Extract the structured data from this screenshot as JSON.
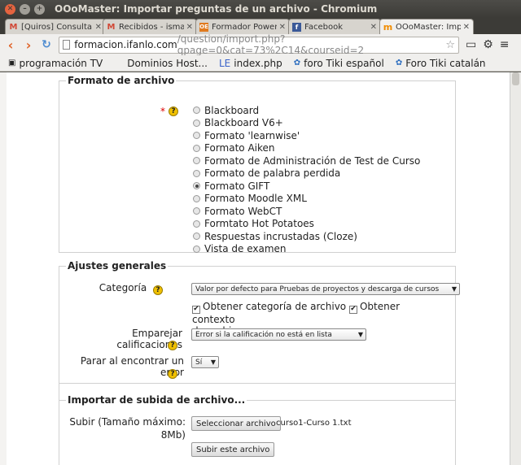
{
  "window": {
    "title": "OOoMaster: Importar preguntas de un archivo - Chromium"
  },
  "tabs": [
    {
      "label": "[Quiros] Consulta",
      "icon": "gmail-icon",
      "color": "#d14836"
    },
    {
      "label": "Recibidos - ismae",
      "icon": "gmail-icon",
      "color": "#d14836"
    },
    {
      "label": "Formador Power",
      "icon": "ooo-icon",
      "color": "#e07a1f"
    },
    {
      "label": "Facebook",
      "icon": "facebook-icon",
      "color": "#3b5998"
    },
    {
      "label": "OOoMaster: Impo",
      "icon": "moodle-icon",
      "color": "#f18c00"
    }
  ],
  "address": {
    "host": "formacion.ifanlo.com",
    "path": "/question/import.php?qpage=0&cat=73%2C14&courseid=2"
  },
  "bookmarks": [
    "programación TV",
    "Dominios Host...",
    "index.php",
    "foro Tiki español",
    "Foro Tiki catalán"
  ],
  "bookmark_prefix": "LE",
  "format_section": {
    "legend": "Formato de archivo",
    "options": [
      "Blackboard",
      "Blackboard V6+",
      "Formato 'learnwise'",
      "Formato Aiken",
      "Formato de Administración de Test de Curso",
      "Formato de palabra perdida",
      "Formato GIFT",
      "Formato Moodle XML",
      "Formato WebCT",
      "Formtato Hot Potatoes",
      "Respuestas incrustadas (Cloze)",
      "Vista de examen"
    ],
    "selected": "Formato GIFT"
  },
  "general_section": {
    "legend": "Ajustes generales",
    "category_label": "Categoría",
    "category_value": "Valor por defecto para Pruebas de proyectos y descarga de cursos",
    "category_from_file": "Obtener categoría de archivo",
    "context_from_file": "Obtener contexto",
    "context_from_file_2": "de archivo",
    "match_grades_label": "Emparejar calificaciones",
    "match_grades_value": "Error si la calificación no está en lista",
    "stop_on_error_label": "Parar al encontrar un error",
    "stop_on_error_value": "Sí"
  },
  "upload_section": {
    "legend": "Importar de subida de archivo...",
    "upload_label_1": "Subir (Tamaño máximo:",
    "upload_label_2": "8Mb)",
    "choose_button": "Seleccionar archivo",
    "chosen_file": "curso1-Curso 1.txt",
    "upload_button": "Subir este archivo"
  },
  "help_glyph": "?",
  "required_glyph": "*"
}
